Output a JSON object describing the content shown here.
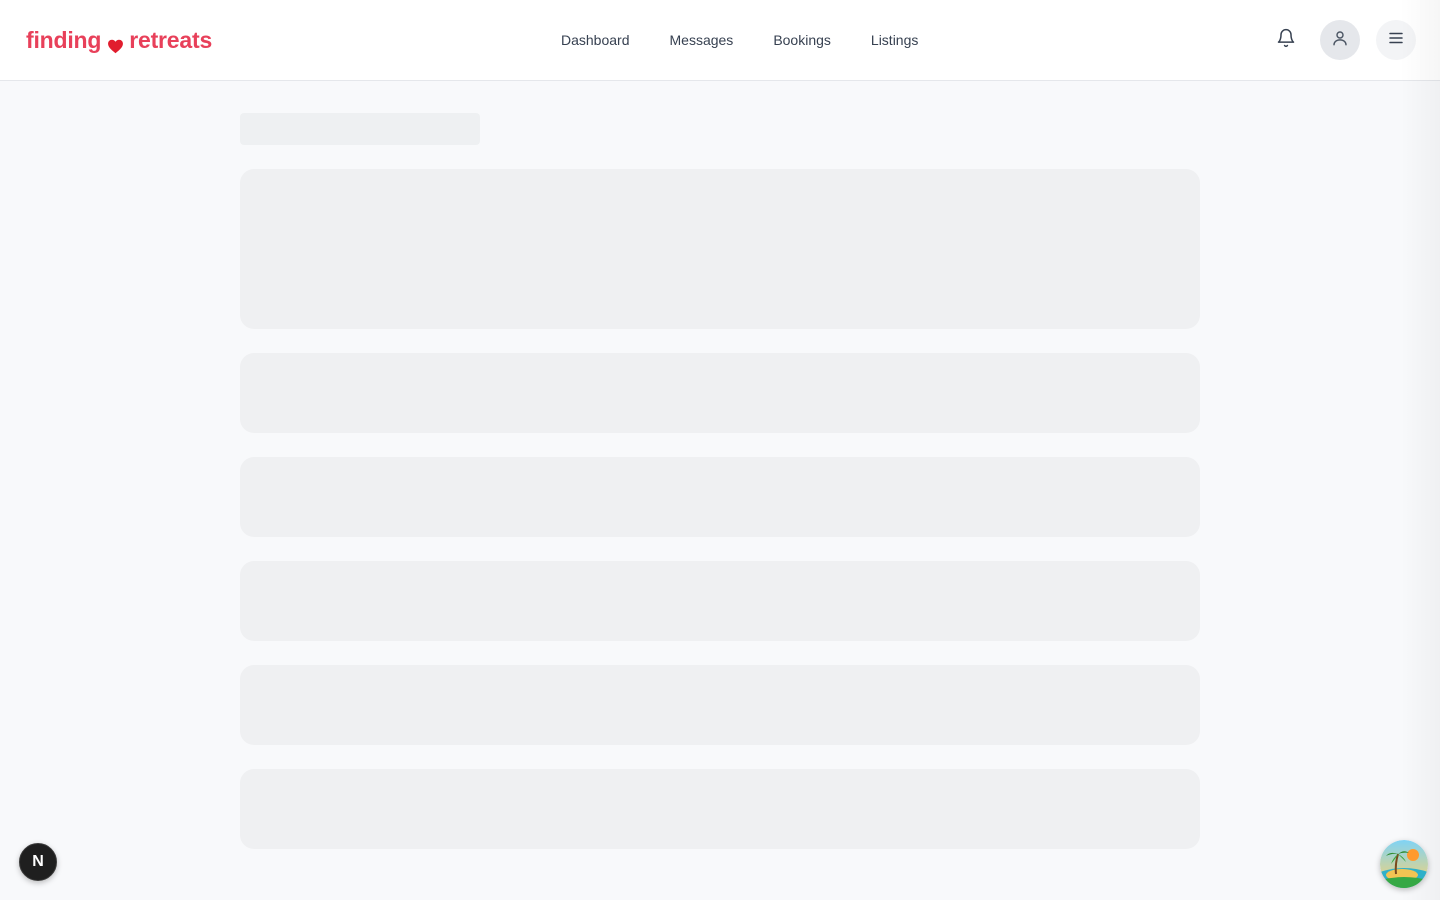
{
  "header": {
    "logo": {
      "word1": "finding",
      "word2": "retreats",
      "icon": "heart-icon",
      "color": "#e8405a",
      "heart_color": "#e11d2e"
    },
    "nav": [
      {
        "label": "Dashboard"
      },
      {
        "label": "Messages"
      },
      {
        "label": "Bookings"
      },
      {
        "label": "Listings"
      }
    ],
    "icons": {
      "bell": "bell-icon",
      "user": "user-icon",
      "menu": "hamburger-menu-icon"
    }
  },
  "loading_state": {
    "skeletons": [
      "title",
      "hero",
      "row",
      "row",
      "row",
      "row",
      "row"
    ],
    "skeleton_color": "#eff0f2"
  },
  "dev_badge": {
    "letter": "N",
    "icon": "nextjs-icon"
  },
  "assistant_badge": {
    "icon": "tropical-island-icon"
  },
  "colors": {
    "background": "#f8f9fb",
    "header_bg": "#ffffff",
    "nav_text": "#374151"
  }
}
